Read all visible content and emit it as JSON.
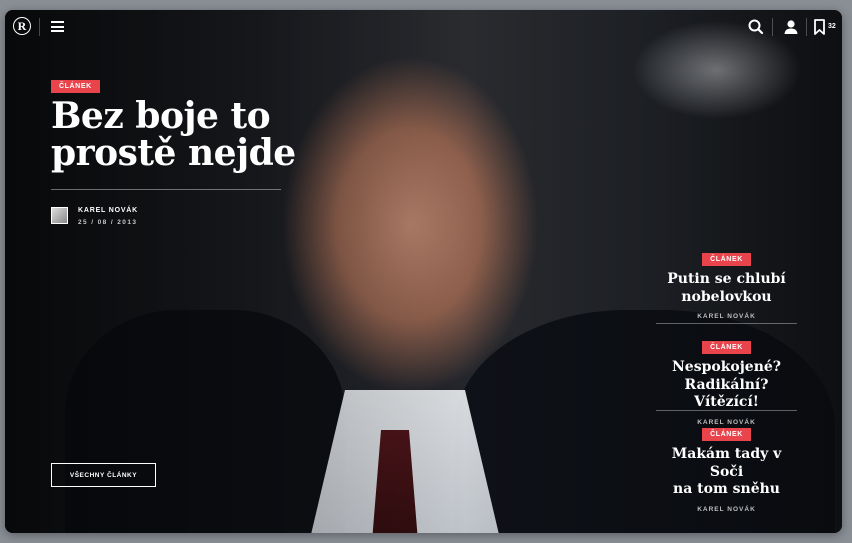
{
  "header": {
    "logo_text": "R",
    "bookmarks_count": "32",
    "icons": [
      "menu-icon",
      "search-icon",
      "user-icon",
      "bookmark-icon"
    ]
  },
  "main_article": {
    "tag": "ČLÁNEK",
    "title": "Bez boje to\nprostě nejde",
    "author": "KAREL NOVÁK",
    "date": "25 / 08 / 2013"
  },
  "all_articles_button": "VŠECHNY ČLÁNKY",
  "side_articles": [
    {
      "tag": "ČLÁNEK",
      "title": "Putin se chlubí\nnobelovkou",
      "author": "KAREL NOVÁK"
    },
    {
      "tag": "ČLÁNEK",
      "title": "Nespokojené?\nRadikální? Vítězící!",
      "author": "KAREL NOVÁK"
    },
    {
      "tag": "ČLÁNEK",
      "title": "Makám tady v Soči\nna tom sněhu",
      "author": "KAREL NOVÁK"
    }
  ],
  "colors": {
    "accent": "#e9434b",
    "text": "#ffffff"
  }
}
